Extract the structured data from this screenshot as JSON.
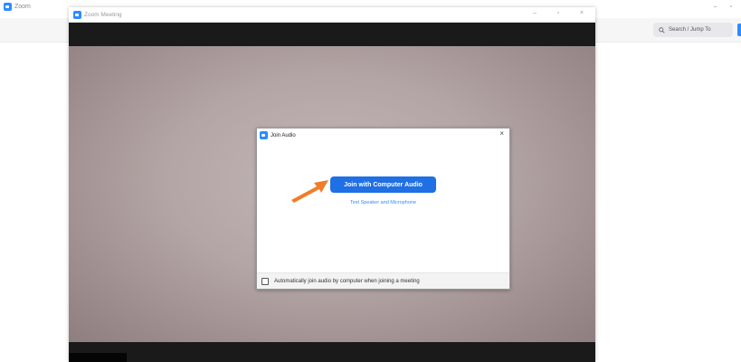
{
  "background_app": {
    "title": "Zoom",
    "search": {
      "placeholder": "Search / Jump To",
      "icon": "search-icon"
    },
    "window_controls": [
      "–",
      "▫"
    ]
  },
  "meeting_window": {
    "title": "Zoom Meeting",
    "window_controls": [
      "–",
      "▫",
      "×"
    ]
  },
  "join_audio_dialog": {
    "title": "Join Audio",
    "close": "×",
    "primary_button": "Join with Computer Audio",
    "test_link": "Test Speaker and Microphone",
    "auto_join_checkbox": {
      "label": "Automatically join audio by computer when joining a meeting",
      "checked": false
    }
  },
  "colors": {
    "accent": "#1f6fe5",
    "zoom_blue": "#2d8cff",
    "pointer_arrow": "#f07c2a",
    "meeting_bar": "#1a1a1a"
  }
}
